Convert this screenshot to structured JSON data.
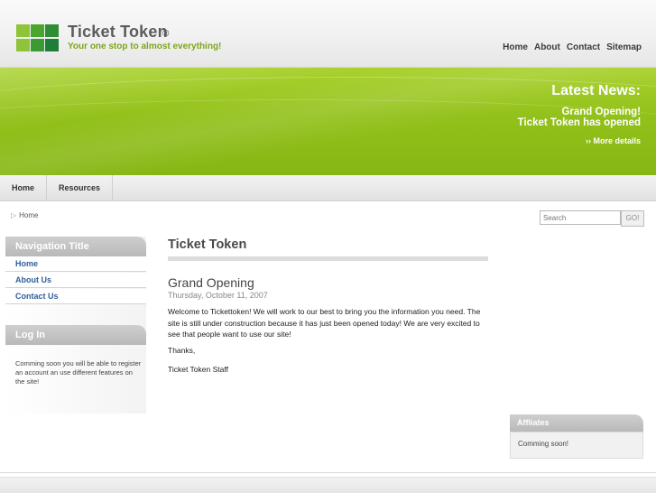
{
  "brand": {
    "title": "Ticket Token",
    "reg_mark": "®",
    "tagline": "Your one stop to almost everything!",
    "logo_colors": [
      "#8fc33a",
      "#4aa52e",
      "#2f8d35",
      "#1f7d3a",
      "#8fc33a",
      "#3a9a33"
    ]
  },
  "top_nav": {
    "items": [
      "Home",
      "About",
      "Contact",
      "Sitemap"
    ]
  },
  "banner": {
    "heading": "Latest News:",
    "line1": "Grand Opening!",
    "line2": "Ticket Token has opened",
    "more_link": "›› More details"
  },
  "tabs": [
    "Home",
    "Resources"
  ],
  "breadcrumb": {
    "arrow": "▷",
    "label": "Home"
  },
  "search": {
    "placeholder": "Search",
    "button_label": "GO!"
  },
  "sidebar": {
    "nav_title": "Navigation Title",
    "items": [
      "Home",
      "About Us",
      "Contact Us"
    ],
    "login_title": "Log In",
    "login_note": "Comming soon you will be able to register an account an use different features on the site!"
  },
  "main": {
    "title": "Ticket Token",
    "post_title": "Grand Opening",
    "post_date": "Thursday, October 11, 2007",
    "post_body": "Welcome to Tickettoken! We will work to our best to bring you the information you need. The site is still under construction because it has just been opened today! We are very excited to see that people want to use our site!",
    "thanks": "Thanks,",
    "signature": "Ticket Token Staff"
  },
  "affiliates": {
    "title": "Affliates",
    "body": "Comming soon!"
  },
  "colors": {
    "accent_green": "#93c11b",
    "link_blue": "#2f5d99",
    "tagline_green": "#7ea61a"
  }
}
